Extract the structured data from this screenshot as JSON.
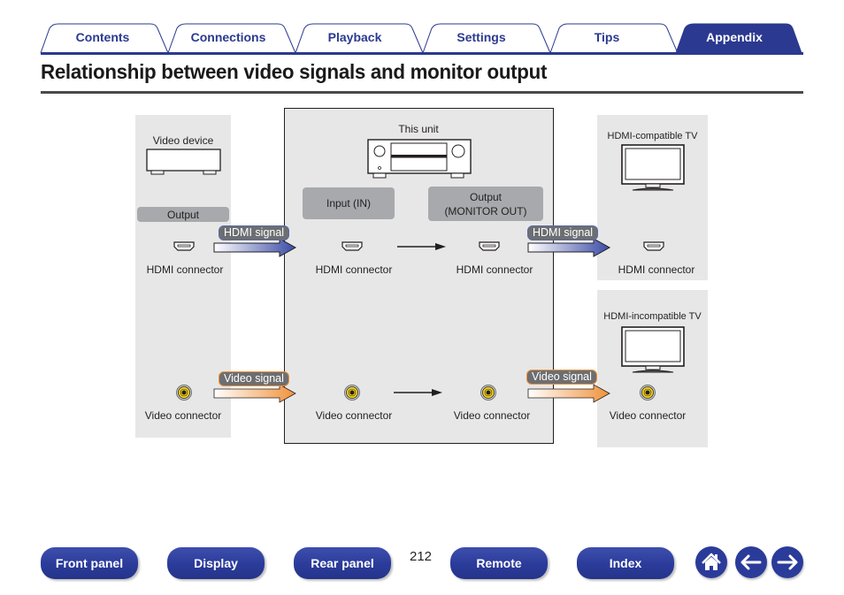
{
  "tabs": [
    {
      "label": "Contents",
      "active": false
    },
    {
      "label": "Connections",
      "active": false
    },
    {
      "label": "Playback",
      "active": false
    },
    {
      "label": "Settings",
      "active": false
    },
    {
      "label": "Tips",
      "active": false
    },
    {
      "label": "Appendix",
      "active": true
    }
  ],
  "page": {
    "title": "Relationship between video signals and monitor output",
    "number": "212"
  },
  "diagram": {
    "source": {
      "title": "Video device",
      "box_label": "Output",
      "hdmi_connector": "HDMI connector",
      "video_connector": "Video connector"
    },
    "unit": {
      "title": "This unit",
      "input_label": "Input (IN)",
      "output_label_line1": "Output",
      "output_label_line2": "(MONITOR OUT)",
      "hdmi_in_connector": "HDMI connector",
      "hdmi_out_connector": "HDMI connector",
      "video_in_connector": "Video connector",
      "video_out_connector": "Video connector"
    },
    "tv_hdmi": {
      "title": "HDMI-compatible TV",
      "connector": "HDMI connector"
    },
    "tv_nonhdmi": {
      "title": "HDMI-incompatible TV",
      "connector": "Video connector"
    },
    "signals": {
      "hdmi": "HDMI signal",
      "video": "Video signal"
    },
    "colors": {
      "hdmi_arrow": "#3b4ba6",
      "video_arrow": "#f0923a",
      "panel_bg": "#e7e7e8",
      "video_jack": "#f2d21b"
    }
  },
  "footer": {
    "buttons": [
      "Front panel",
      "Display",
      "Rear panel",
      "Remote",
      "Index"
    ],
    "icons": [
      "home-icon",
      "back-arrow-icon",
      "forward-arrow-icon"
    ]
  },
  "theme": {
    "brand": "#2b3990"
  }
}
